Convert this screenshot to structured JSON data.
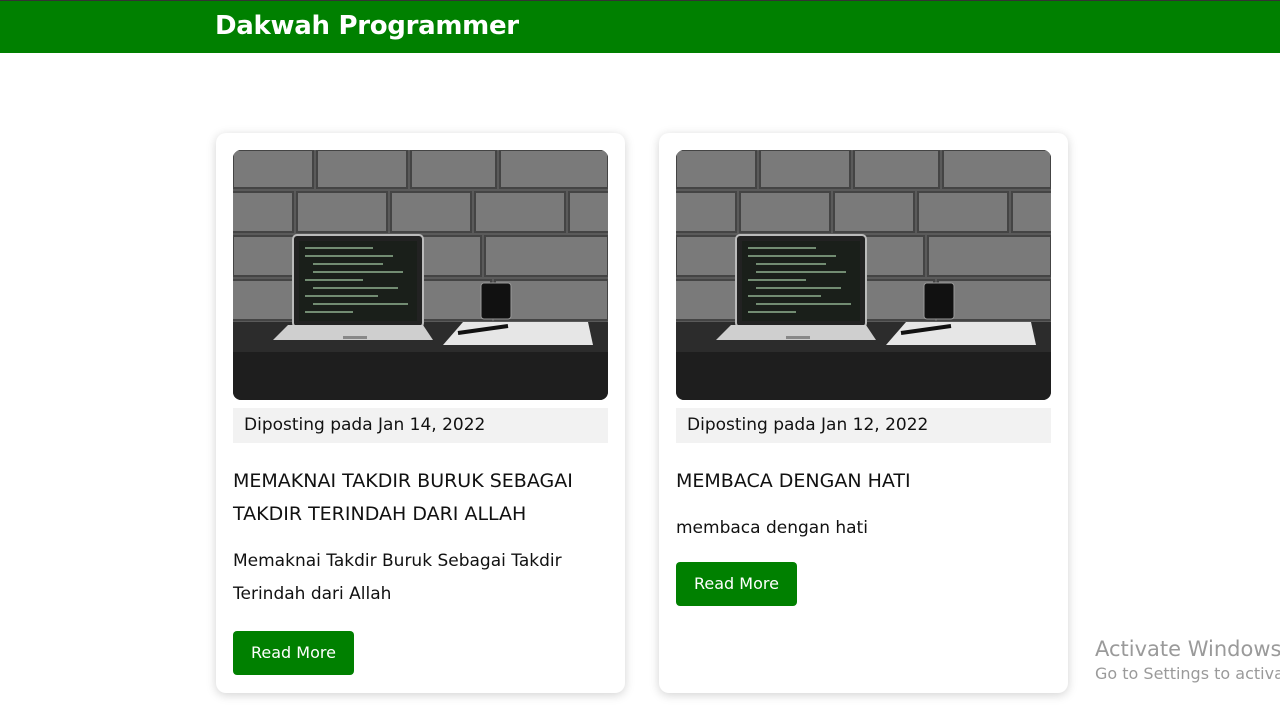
{
  "header": {
    "brand": "Dakwah Programmer"
  },
  "colors": {
    "primary": "#008000",
    "date_bg": "#f2f2f2"
  },
  "posts": [
    {
      "image": "laptop-on-desk-photo",
      "date": "Diposting pada Jan 14, 2022",
      "title": "MEMAKNAI TAKDIR BURUK SEBAGAI TAKDIR TERINDAH DARI ALLAH",
      "excerpt": "Memaknai Takdir Buruk Sebagai Takdir Terindah dari Allah",
      "button": "Read More"
    },
    {
      "image": "laptop-on-desk-photo",
      "date": "Diposting pada Jan 12, 2022",
      "title": "MEMBACA DENGAN HATI",
      "excerpt": "membaca dengan hati",
      "button": "Read More"
    }
  ],
  "watermark": {
    "line1": "Activate Windows",
    "line2": "Go to Settings to activate"
  }
}
